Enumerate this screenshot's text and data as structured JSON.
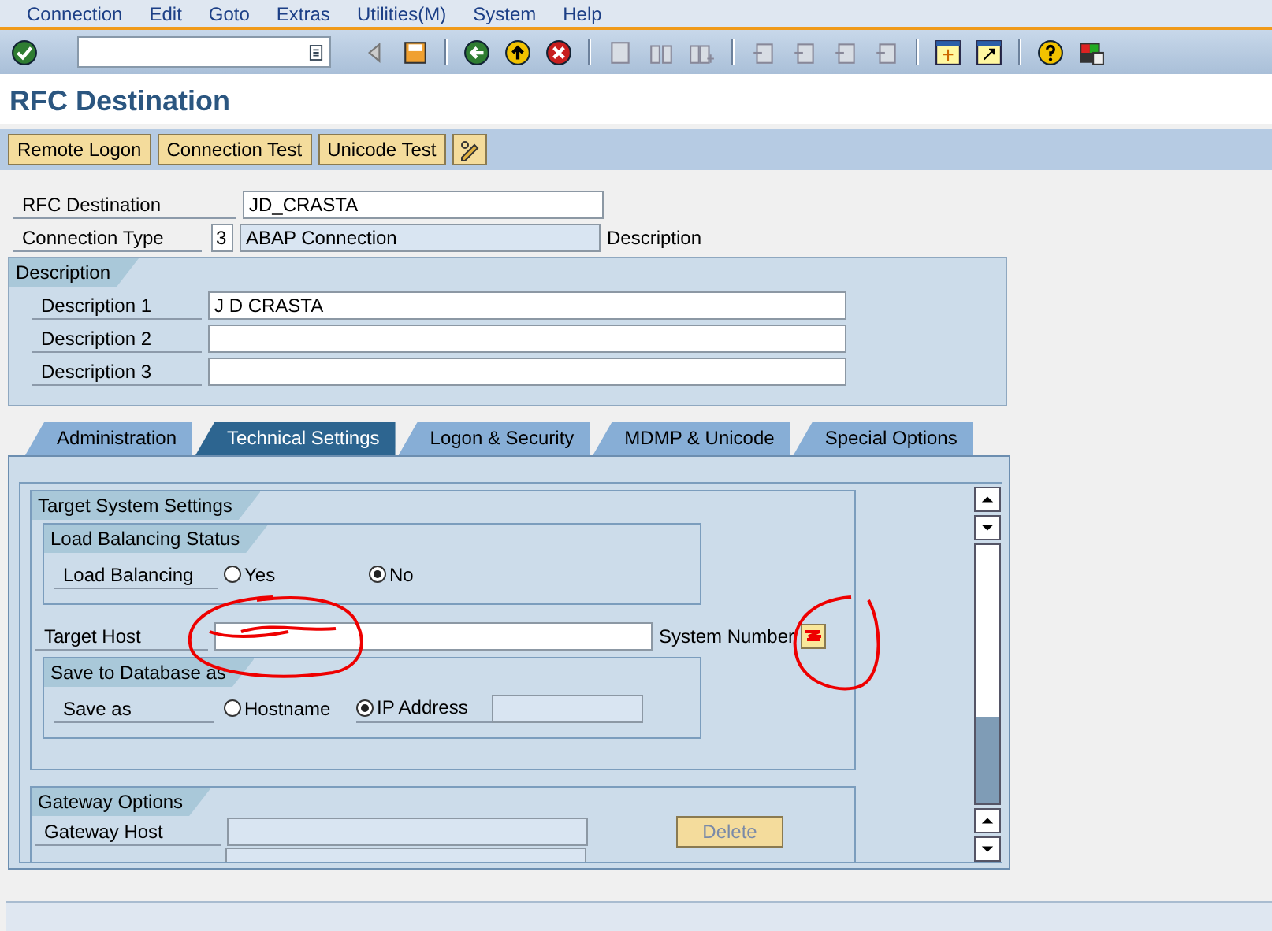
{
  "menu": [
    "Connection",
    "Edit",
    "Goto",
    "Extras",
    "Utilities(M)",
    "System",
    "Help"
  ],
  "title": "RFC Destination",
  "app_buttons": [
    "Remote Logon",
    "Connection Test",
    "Unicode Test"
  ],
  "header": {
    "rfc_destination": {
      "label": "RFC Destination",
      "value": "JD_CRASTA"
    },
    "connection_type": {
      "label": "Connection Type",
      "code": "3",
      "value": "ABAP Connection"
    },
    "description_label": "Description"
  },
  "description_group": {
    "title": "Description",
    "fields": [
      {
        "label": "Description 1",
        "value": "J D CRASTA"
      },
      {
        "label": "Description 2"
      },
      {
        "label": "Description 3"
      }
    ]
  },
  "tabs": [
    {
      "label": "Administration",
      "selected": false
    },
    {
      "label": "Technical Settings",
      "selected": true
    },
    {
      "label": "Logon & Security",
      "selected": false
    },
    {
      "label": "MDMP & Unicode",
      "selected": false
    },
    {
      "label": "Special Options",
      "selected": false
    }
  ],
  "target_system": {
    "title": "Target System Settings",
    "load_balancing": {
      "title": "Load Balancing Status",
      "label": "Load Balancing",
      "options": [
        {
          "label": "Yes",
          "selected": false
        },
        {
          "label": "No",
          "selected": true
        }
      ]
    },
    "target_host": {
      "label": "Target Host"
    },
    "system_number": {
      "label": "System Number"
    },
    "save_db": {
      "title": "Save to Database as",
      "label": "Save as",
      "options": [
        {
          "label": "Hostname",
          "selected": false
        },
        {
          "label": "IP Address",
          "selected": true
        }
      ]
    }
  },
  "gateway": {
    "title": "Gateway Options",
    "host_label": "Gateway Host",
    "delete_button": {
      "label": "Delete",
      "disabled": true
    }
  }
}
